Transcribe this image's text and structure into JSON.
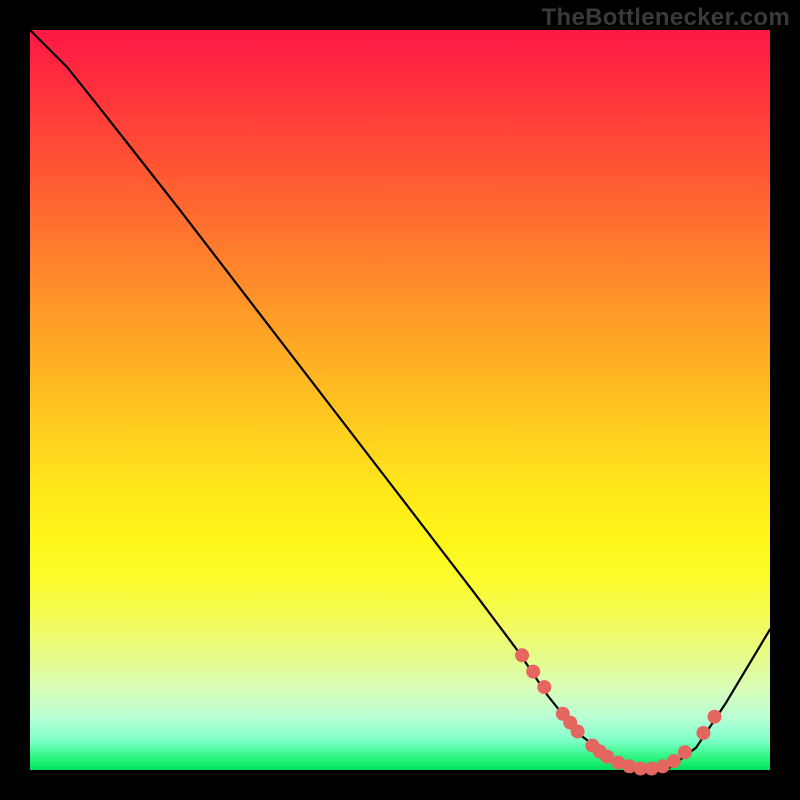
{
  "watermark": "TheBottlenecker.com",
  "chart_data": {
    "type": "line",
    "title": "",
    "xlabel": "",
    "ylabel": "",
    "xlim": [
      0,
      100
    ],
    "ylim": [
      0,
      100
    ],
    "background_gradient": {
      "orientation": "vertical",
      "stops": [
        {
          "pos": 0,
          "color": "#ff1846"
        },
        {
          "pos": 50,
          "color": "#ffd11e"
        },
        {
          "pos": 80,
          "color": "#f4fb52"
        },
        {
          "pos": 100,
          "color": "#00e05a"
        }
      ]
    },
    "series": [
      {
        "name": "bottleneck-curve",
        "x": [
          0,
          5,
          9,
          20,
          30,
          40,
          50,
          60,
          66,
          70,
          74,
          78,
          82,
          86,
          90,
          94,
          100
        ],
        "y": [
          100,
          95,
          90,
          76,
          63,
          50,
          37,
          24,
          16,
          10,
          5,
          2,
          0,
          0,
          3,
          9,
          19
        ]
      }
    ],
    "markers": {
      "name": "highlight-points",
      "color": "#e4665e",
      "points_x": [
        66.5,
        68,
        69.5,
        72,
        73,
        74,
        76,
        77,
        78,
        79.5,
        81,
        82.5,
        84,
        85.5,
        87,
        88.5,
        91,
        92.5
      ],
      "points_y": [
        15.5,
        13.3,
        11.2,
        7.6,
        6.4,
        5.2,
        3.3,
        2.5,
        1.8,
        1.0,
        0.5,
        0.2,
        0.2,
        0.5,
        1.2,
        2.4,
        5.0,
        7.2
      ]
    }
  }
}
